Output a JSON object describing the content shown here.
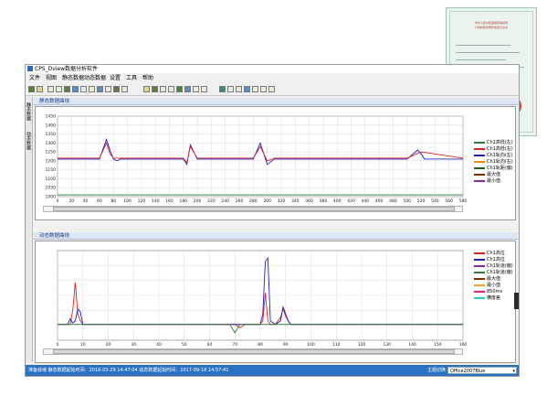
{
  "window": {
    "title": "CPS_Dview数据分析软件",
    "menu": [
      "文件",
      "视图",
      "静态数据",
      "动态数据",
      "设置",
      "工具",
      "帮助"
    ]
  },
  "left_tabs": [
    "静态数据",
    "动态数据"
  ],
  "static_panel": {
    "header": "静态数据曲线",
    "y_ticks": [
      "1450",
      "1400",
      "1350",
      "1300",
      "1250",
      "1200",
      "1150",
      "1100",
      "1050",
      "1000"
    ],
    "x_ticks": [
      "0",
      "20",
      "40",
      "60",
      "80",
      "100",
      "120",
      "140",
      "160",
      "180",
      "200",
      "220",
      "240",
      "260",
      "280",
      "300",
      "320",
      "340",
      "360",
      "380",
      "400",
      "420",
      "440",
      "460",
      "480",
      "500",
      "520",
      "540",
      "560",
      "580"
    ],
    "x_unit": "X(mm)",
    "legend": [
      "Ch1高低(左)",
      "Ch1高低(右)",
      "Ch1轨向(左)",
      "Ch1轨向(右)",
      "Ch1轨距(偏)",
      "最大值",
      "最小值"
    ]
  },
  "dynamic_panel": {
    "header": "动态数据曲线",
    "x_ticks": [
      "0",
      "10",
      "20",
      "30",
      "40",
      "50",
      "60",
      "70",
      "80",
      "90",
      "100",
      "110",
      "120",
      "130",
      "140",
      "150",
      "160"
    ],
    "legend": [
      "Ch1高位",
      "Ch1高位",
      "Ch1轨道(偏)",
      "Ch1轨道(偏)",
      "最大值",
      "最小值",
      "850mv",
      "横度差"
    ]
  },
  "status_bar": {
    "text": "准备就绪    静态数据起始时间：2016-03-29 14:47:04  动态数据起始时间：2017-09-18 14:57:41",
    "combo_label": "主题切换",
    "combo_value": "Office2007Blue"
  },
  "certificate": {
    "lines": [
      "中华人民共和国国家版权局",
      "计算机软件著作权登记证书"
    ]
  },
  "colors": {
    "accent_blue": "#2b72c4",
    "series_blue": "#1f1fc0",
    "series_red": "#e02020",
    "series_green": "#2e7d32",
    "series_darkgreen": "#1b5e20"
  },
  "chart_data": [
    {
      "type": "line",
      "title": "静态数据曲线",
      "xlabel": "X(mm)",
      "xlim": [
        0,
        580
      ],
      "ylim": [
        1000,
        1450
      ],
      "grid": true,
      "legend_position": "right",
      "series": [
        {
          "name": "Ch1高低(左)",
          "color": "#2e7d32",
          "x": [
            0,
            580
          ],
          "y": [
            1010,
            1010
          ]
        },
        {
          "name": "Ch1轨距(偏)",
          "color": "#1f1fc0",
          "x": [
            0,
            60,
            70,
            75,
            80,
            85,
            90,
            180,
            185,
            190,
            200,
            205,
            280,
            290,
            300,
            310,
            320,
            330,
            500,
            515,
            520,
            525,
            580
          ],
          "y": [
            1210,
            1210,
            1320,
            1260,
            1210,
            1200,
            1210,
            1210,
            1180,
            1290,
            1210,
            1210,
            1210,
            1300,
            1180,
            1210,
            1210,
            1210,
            1210,
            1260,
            1240,
            1210,
            1210
          ]
        },
        {
          "name": "Ch1轨向(右)",
          "color": "#e02020",
          "x": [
            0,
            60,
            70,
            75,
            80,
            180,
            185,
            190,
            200,
            280,
            290,
            300,
            310,
            500,
            520,
            580
          ],
          "y": [
            1215,
            1215,
            1300,
            1240,
            1215,
            1215,
            1190,
            1280,
            1215,
            1215,
            1280,
            1200,
            1215,
            1215,
            1250,
            1215
          ]
        }
      ]
    },
    {
      "type": "line",
      "title": "动态数据曲线",
      "xlim": [
        0,
        160
      ],
      "grid": true,
      "legend_position": "right",
      "series": [
        {
          "name": "Ch1高位",
          "color": "#e02020",
          "x": [
            0,
            5,
            6,
            7,
            8,
            9,
            10,
            70,
            72,
            74,
            80,
            81,
            82,
            83,
            84,
            86,
            88,
            89,
            90,
            91,
            92,
            160
          ],
          "y": [
            0,
            0,
            20,
            60,
            15,
            5,
            0,
            0,
            -5,
            0,
            0,
            5,
            45,
            5,
            0,
            0,
            10,
            22,
            12,
            5,
            0,
            0
          ]
        },
        {
          "name": "Ch1高位",
          "color": "#1f1fc0",
          "x": [
            0,
            4,
            5,
            6,
            7,
            8,
            9,
            10,
            80,
            81,
            82,
            83,
            84,
            86,
            88,
            89,
            90,
            91,
            92,
            160
          ],
          "y": [
            0,
            0,
            8,
            2,
            5,
            22,
            18,
            0,
            0,
            15,
            90,
            95,
            5,
            0,
            5,
            25,
            15,
            5,
            0,
            0
          ]
        },
        {
          "name": "Ch1轨道(偏)",
          "color": "#2e7d32",
          "x": [
            0,
            68,
            70,
            72,
            160
          ],
          "y": [
            0,
            0,
            -12,
            0,
            0
          ]
        }
      ]
    }
  ]
}
